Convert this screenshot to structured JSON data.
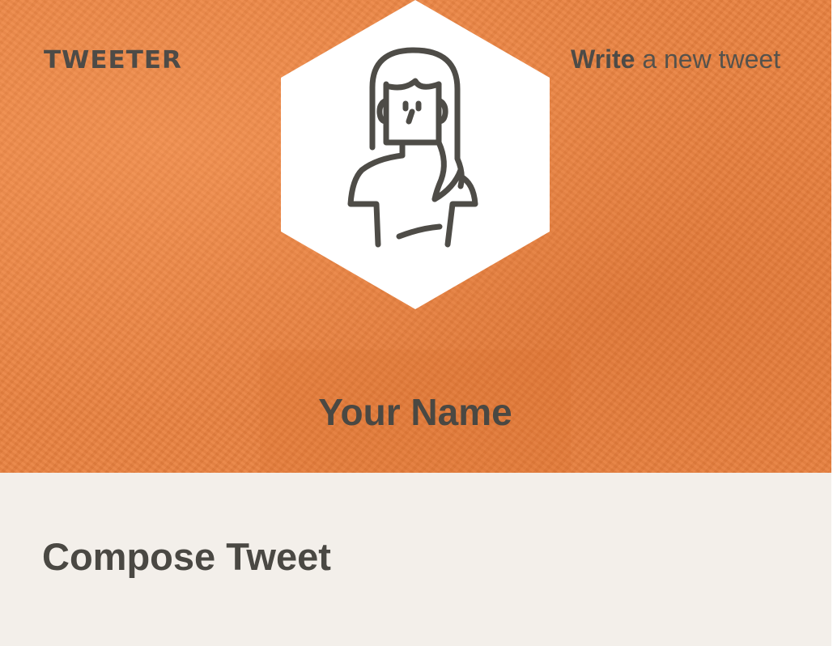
{
  "brand": {
    "logo_text": "TWEETER"
  },
  "nav": {
    "write_strong": "Write",
    "write_rest": " a new tweet"
  },
  "profile": {
    "name": "Your Name",
    "avatar_icon": "woman-avatar-icon"
  },
  "main": {
    "heading": "Compose Tweet"
  },
  "colors": {
    "header_bg": "#e9813f",
    "page_bg": "#f3efea",
    "text": "#4a4843",
    "hex_fill": "#ffffff"
  }
}
